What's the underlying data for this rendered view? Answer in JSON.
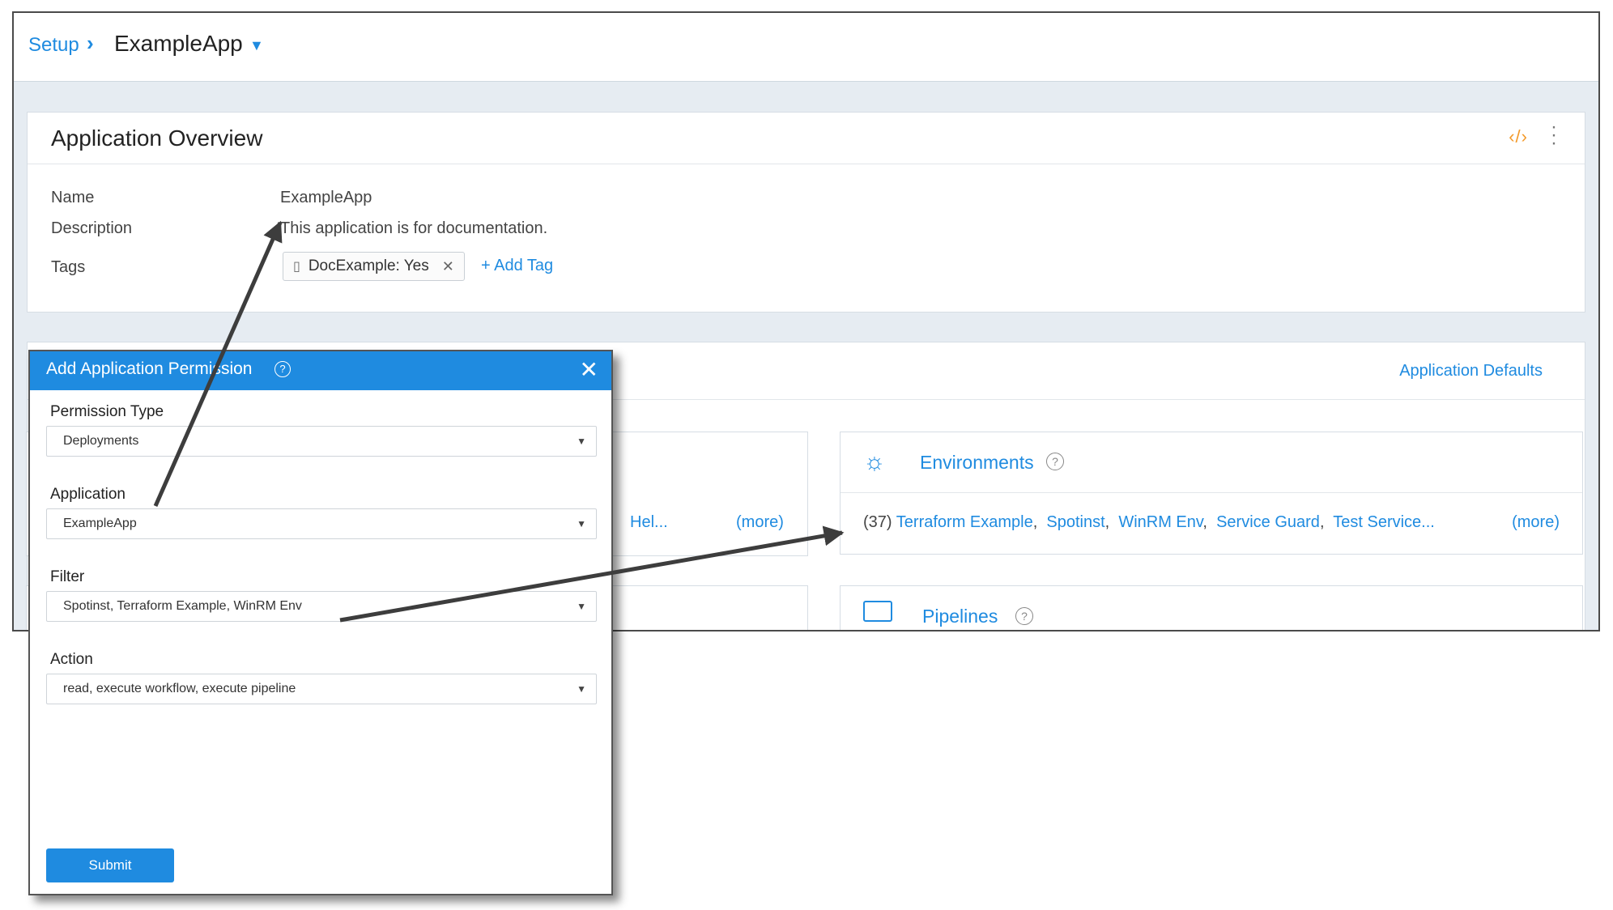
{
  "breadcrumb": {
    "root": "Setup",
    "current": "ExampleApp"
  },
  "overview": {
    "title": "Application Overview",
    "name_label": "Name",
    "name_value": "ExampleApp",
    "description_label": "Description",
    "description_value": "This application is for documentation.",
    "tags_label": "Tags",
    "tag": "DocExample: Yes",
    "add_tag": "+ Add Tag"
  },
  "section": {
    "app_defaults": "Application Defaults",
    "left_card": {
      "partial_link": "Hel...",
      "more": "(more)"
    },
    "environments": {
      "title": "Environments",
      "count": "(37)",
      "items": [
        "Terraform Example",
        "Spotinst",
        "WinRM Env",
        "Service Guard",
        "Test Service..."
      ],
      "more": "(more)"
    },
    "pipelines": {
      "title": "Pipelines"
    }
  },
  "dialog": {
    "title": "Add Application Permission",
    "permission_type_label": "Permission Type",
    "permission_type_value": "Deployments",
    "application_label": "Application",
    "application_value": "ExampleApp",
    "filter_label": "Filter",
    "filter_value": "Spotinst,  Terraform Example,  WinRM Env",
    "action_label": "Action",
    "action_value": "read,  execute workflow,  execute pipeline",
    "submit": "Submit"
  },
  "colors": {
    "accent": "#1f8be0",
    "code_icon": "#f39a2b",
    "arrow": "#3d3d3d"
  },
  "icons": [
    "chevron-right-icon",
    "caret-down-icon",
    "code-icon",
    "more-vertical-icon",
    "document-icon",
    "close-icon",
    "help-icon",
    "sun-icon",
    "pipeline-icon"
  ]
}
